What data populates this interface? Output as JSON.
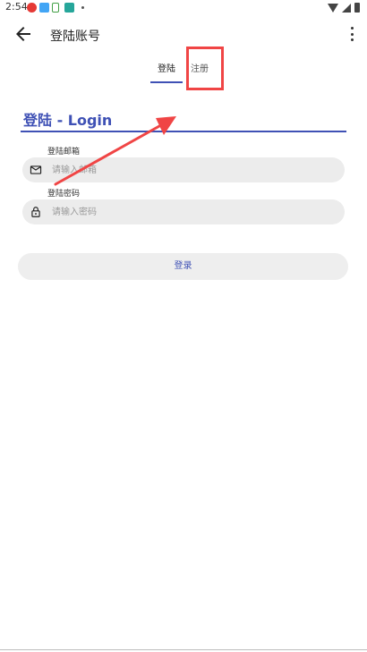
{
  "status_bar": {
    "time": "2:54"
  },
  "app_bar": {
    "title": "登陆账号"
  },
  "tabs": [
    {
      "label": "登陆",
      "selected": true
    },
    {
      "label": "注册",
      "selected": false
    }
  ],
  "login": {
    "heading": "登陆 - Login",
    "email_label": "登陆邮箱",
    "email_placeholder": "请输入邮箱",
    "password_label": "登陆密码",
    "password_placeholder": "请输入密码",
    "submit_label": "登录"
  },
  "colors": {
    "accent": "#3f51b5",
    "annotation": "#f04545",
    "field_bg": "#ececec"
  }
}
